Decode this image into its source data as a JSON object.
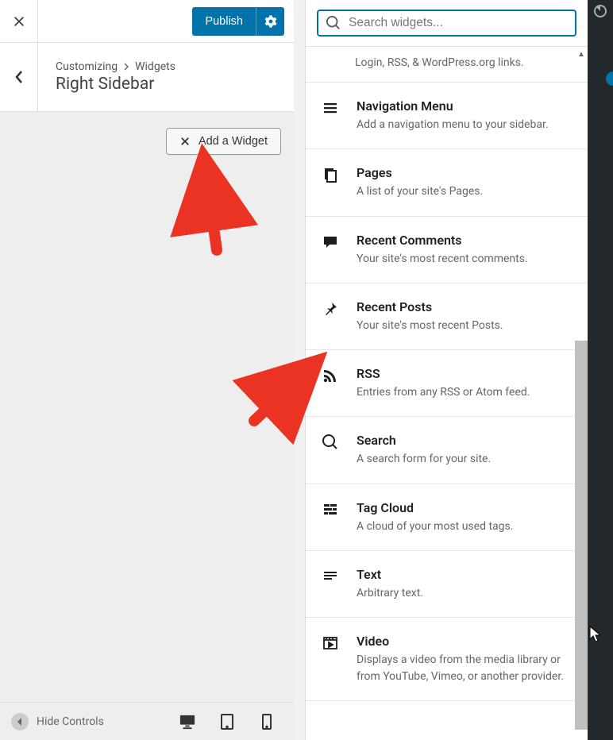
{
  "header": {
    "publish_label": "Publish"
  },
  "breadcrumb": {
    "prefix": "Customizing",
    "section": "Widgets",
    "title": "Right Sidebar"
  },
  "add_widget_label": "Add a Widget",
  "footer": {
    "hide_controls_label": "Hide Controls"
  },
  "search": {
    "placeholder": "Search widgets..."
  },
  "partial_item_desc": "Login, RSS, & WordPress.org links.",
  "widgets": [
    {
      "icon": "menu",
      "title": "Navigation Menu",
      "desc": "Add a navigation menu to your sidebar."
    },
    {
      "icon": "pages",
      "title": "Pages",
      "desc": "A list of your site's Pages."
    },
    {
      "icon": "comment",
      "title": "Recent Comments",
      "desc": "Your site's most recent comments."
    },
    {
      "icon": "pin",
      "title": "Recent Posts",
      "desc": "Your site's most recent Posts."
    },
    {
      "icon": "rss",
      "title": "RSS",
      "desc": "Entries from any RSS or Atom feed."
    },
    {
      "icon": "search",
      "title": "Search",
      "desc": "A search form for your site."
    },
    {
      "icon": "tagcloud",
      "title": "Tag Cloud",
      "desc": "A cloud of your most used tags."
    },
    {
      "icon": "text",
      "title": "Text",
      "desc": "Arbitrary text."
    },
    {
      "icon": "video",
      "title": "Video",
      "desc": "Displays a video from the media library or from YouTube, Vimeo, or another provider."
    }
  ]
}
